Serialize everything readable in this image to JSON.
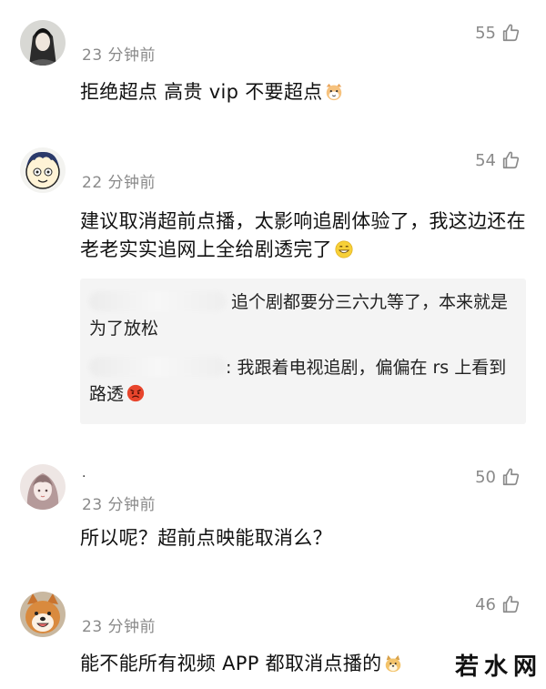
{
  "comments": [
    {
      "time": "23 分钟前",
      "likes": "55",
      "avatar_icon": "ink-portrait-avatar",
      "text": "拒绝超点 高贵 vip 不要超点",
      "emoji_icon": "cat-face-emoji"
    },
    {
      "time": "22 分钟前",
      "likes": "54",
      "avatar_icon": "cartoon-boy-avatar",
      "text": "建议取消超前点播，太影响追剧体验了，我这边还在老老实实追网上全给剧透完了",
      "emoji_icon": "grin-face-emoji",
      "replies": [
        {
          "text": "追个剧都要分三六九等了，本来就是为了放松"
        },
        {
          "text": ": 我跟着电视追剧，偏偏在 rs 上看到路透",
          "emoji_icon": "angry-face-emoji"
        }
      ]
    },
    {
      "username": ".",
      "time": "23 分钟前",
      "likes": "50",
      "avatar_icon": "illustrated-girl-avatar",
      "text": "所以呢？超前点映能取消么？"
    },
    {
      "time": "23 分钟前",
      "likes": "46",
      "avatar_icon": "shiba-dog-avatar",
      "text": "能不能所有视频 APP 都取消点播的",
      "emoji_icon": "dog-emoji"
    }
  ],
  "watermark": {
    "chars": [
      "若",
      "水",
      "网"
    ]
  },
  "colors": {
    "muted": "#8a8a8a",
    "reply_bg": "#f4f4f4",
    "text": "#111111"
  }
}
